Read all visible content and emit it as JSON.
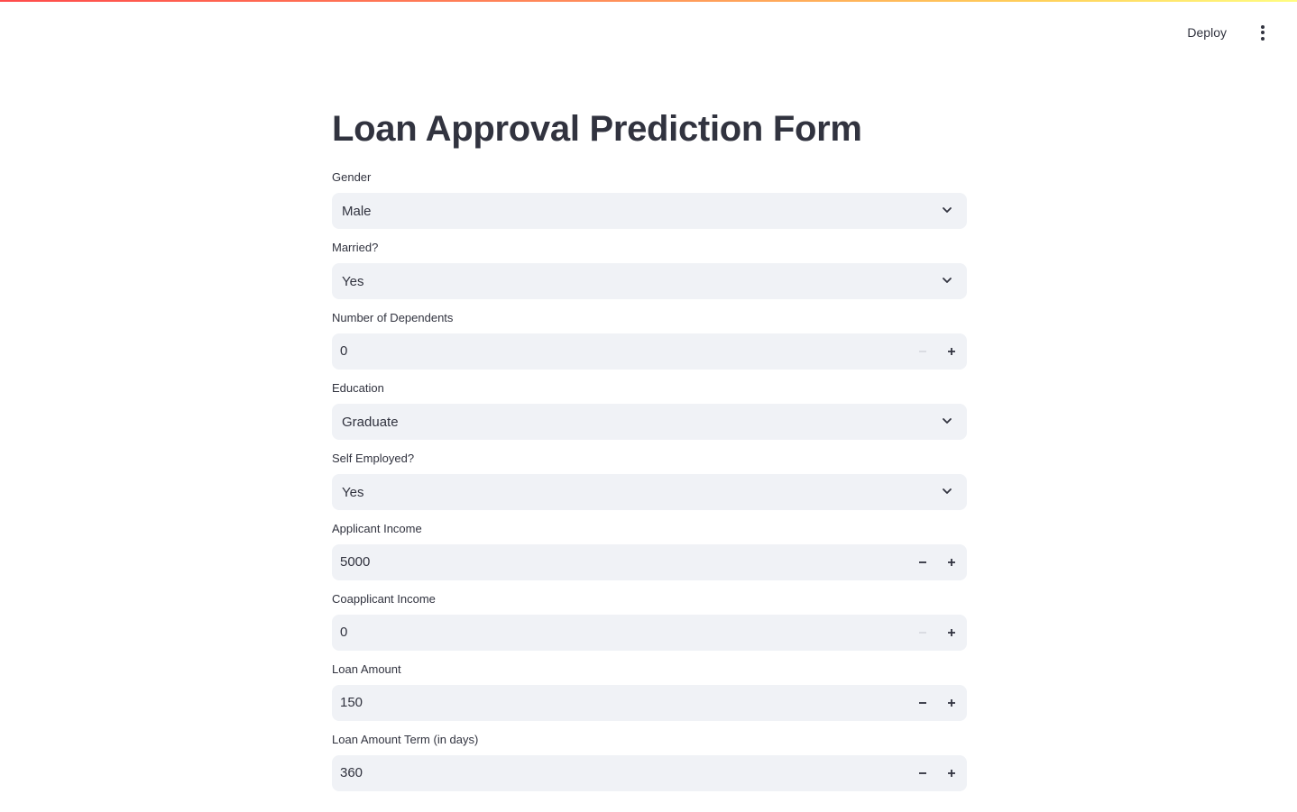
{
  "header": {
    "deploy_label": "Deploy"
  },
  "page": {
    "title": "Loan Approval Prediction Form"
  },
  "form": {
    "gender": {
      "label": "Gender",
      "value": "Male"
    },
    "married": {
      "label": "Married?",
      "value": "Yes"
    },
    "dependents": {
      "label": "Number of Dependents",
      "value": "0",
      "minus_disabled": true
    },
    "education": {
      "label": "Education",
      "value": "Graduate"
    },
    "self_employed": {
      "label": "Self Employed?",
      "value": "Yes"
    },
    "applicant_income": {
      "label": "Applicant Income",
      "value": "5000",
      "minus_disabled": false
    },
    "coapplicant_income": {
      "label": "Coapplicant Income",
      "value": "0",
      "minus_disabled": true
    },
    "loan_amount": {
      "label": "Loan Amount",
      "value": "150",
      "minus_disabled": false
    },
    "loan_term": {
      "label": "Loan Amount Term (in days)",
      "value": "360"
    }
  },
  "icons": {
    "chevron": "chevron-down-icon",
    "minus": "minus-icon",
    "plus": "plus-icon",
    "menu": "kebab-menu-icon"
  },
  "colors": {
    "input_bg": "#f0f2f6",
    "text": "#31333f",
    "disabled_icon": "#c7c9d0"
  }
}
